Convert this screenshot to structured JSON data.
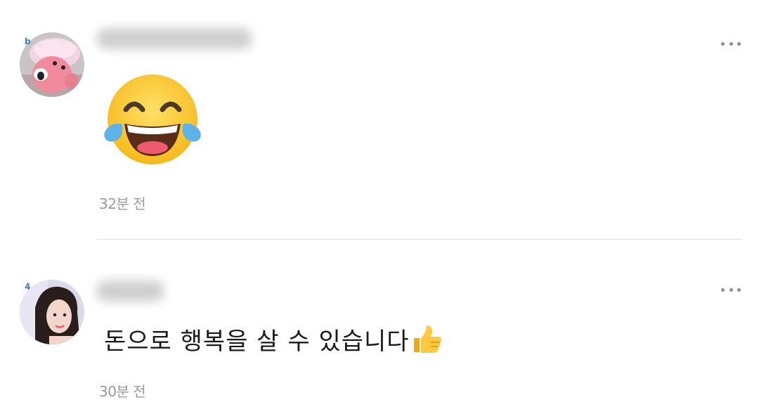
{
  "comments": [
    {
      "level_badge": "b",
      "username": "",
      "avatar": "pink-character-avatar",
      "sticker": "face-with-tears-of-joy-emoji",
      "timestamp": "32분 전",
      "more_icon": "more-options-icon"
    },
    {
      "level_badge": "4",
      "username": "",
      "avatar": "woman-portrait-avatar",
      "text": "돈으로 행복을 살 수 있습니다",
      "text_emoji": "thumbs-up-icon",
      "timestamp": "30분 전",
      "more_icon": "more-options-icon"
    }
  ],
  "colors": {
    "timestamp": "#9a9a9a",
    "text": "#1a1a1a",
    "divider": "#e6e6e6",
    "badge": "#3a7bd5"
  }
}
